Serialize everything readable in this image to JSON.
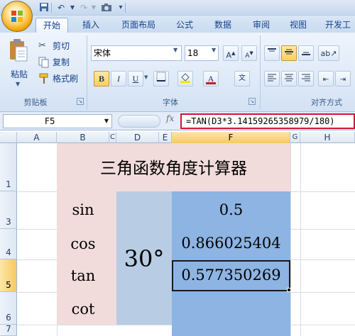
{
  "tabs": [
    "开始",
    "插入",
    "页面布局",
    "公式",
    "数据",
    "审阅",
    "视图",
    "开发工"
  ],
  "clipboard": {
    "paste": "粘贴",
    "cut": "剪切",
    "copy": "复制",
    "format_painter": "格式刷",
    "group_label": "剪贴板"
  },
  "font": {
    "name": "宋体",
    "size": "18",
    "bold": "B",
    "italic": "I",
    "underline": "U",
    "font_color_label": "A",
    "group_label": "字体"
  },
  "alignment": {
    "group_label": "对齐方式"
  },
  "formula_bar": {
    "name_box": "F5",
    "fx": "fx",
    "formula": "=TAN(D3*3.14159265358979/180)"
  },
  "columns": [
    "A",
    "B",
    "C",
    "D",
    "E",
    "F",
    "G",
    "H"
  ],
  "rows": [
    "1",
    "3",
    "4",
    "5",
    "6",
    "7"
  ],
  "sheet": {
    "title": "三角函数角度计算器",
    "functions": [
      "sin",
      "cos",
      "tan",
      "cot"
    ],
    "angle": "30°",
    "results": [
      "0.5",
      "0.866025404",
      "0.577350269"
    ]
  },
  "colors": {
    "title_bg": "#f2dcdb",
    "label_bg": "#f2dcdb",
    "angle_bg": "#b8cce4",
    "result_bg": "#8db4e2",
    "formula_highlight": "#d2143a"
  }
}
